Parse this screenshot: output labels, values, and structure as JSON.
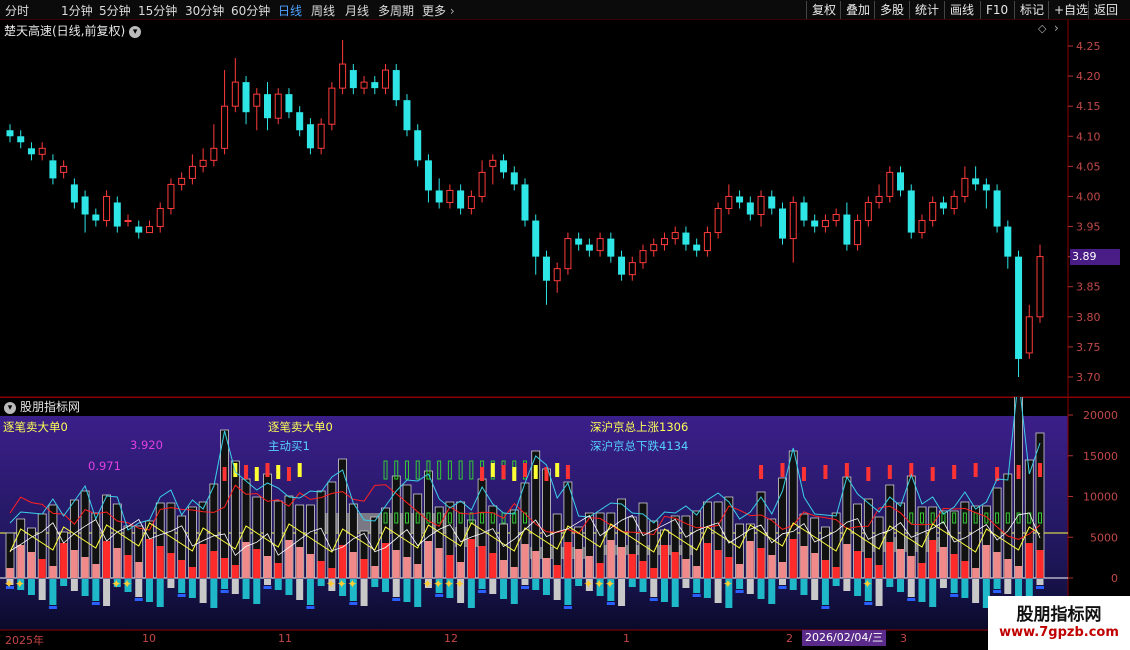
{
  "toolbar": {
    "periods": [
      "分时",
      "1分钟",
      "5分钟",
      "15分钟",
      "30分钟",
      "60分钟",
      "日线",
      "周线",
      "月线",
      "多周期",
      "更多"
    ],
    "active_period": "日线",
    "buttons": [
      "复权",
      "叠加",
      "多股",
      "统计",
      "画线",
      "F10",
      "标记",
      "+自选",
      "返回"
    ]
  },
  "header": {
    "stock_title": "楚天高速(日线,前复权)"
  },
  "price_axis": {
    "ticks": [
      "4.25",
      "4.20",
      "4.15",
      "4.10",
      "4.05",
      "4.00",
      "3.95",
      "3.90",
      "3.85",
      "3.80",
      "3.75",
      "3.70"
    ],
    "cursor_price": "3.89"
  },
  "indicator": {
    "panel_title": "股朋指标网",
    "labels": {
      "big_sell_single_left": "逐笔卖大单0",
      "value_a": "3.920",
      "value_b": "0.971",
      "big_sell_single_mid": "逐笔卖大单0",
      "active_buy": "主动买1",
      "market_up": "深沪京总上涨1306",
      "market_down": "深沪京总下跌4134"
    },
    "axis_ticks": [
      "20000",
      "15000",
      "10000",
      "5000",
      "0"
    ]
  },
  "x_axis": {
    "labels": [
      "2025年",
      "10",
      "11",
      "12",
      "1",
      "2",
      "3"
    ],
    "cursor_date": "2026/02/04/三"
  },
  "watermark": {
    "title": "股朋指标网",
    "url": "www.7gpzb.com"
  },
  "colors": {
    "up": "#ff3b3b",
    "down": "#2ee6e6",
    "axis": "#8b0000",
    "indicator_bg": "#2a1a6e"
  },
  "chart_data": {
    "type": "candlestick",
    "ylim": [
      3.68,
      4.28
    ],
    "candles": [
      [
        4.11,
        4.1,
        4.12,
        4.09
      ],
      [
        4.1,
        4.09,
        4.11,
        4.08
      ],
      [
        4.08,
        4.07,
        4.09,
        4.06
      ],
      [
        4.07,
        4.08,
        4.09,
        4.06
      ],
      [
        4.06,
        4.03,
        4.07,
        4.02
      ],
      [
        4.04,
        4.05,
        4.06,
        4.03
      ],
      [
        4.02,
        3.99,
        4.03,
        3.98
      ],
      [
        4.0,
        3.97,
        4.01,
        3.94
      ],
      [
        3.97,
        3.96,
        3.98,
        3.95
      ],
      [
        3.96,
        4.0,
        4.01,
        3.95
      ],
      [
        3.99,
        3.95,
        4.0,
        3.94
      ],
      [
        3.96,
        3.96,
        3.97,
        3.95
      ],
      [
        3.95,
        3.94,
        3.96,
        3.93
      ],
      [
        3.94,
        3.95,
        3.96,
        3.94
      ],
      [
        3.95,
        3.98,
        3.99,
        3.94
      ],
      [
        3.98,
        4.02,
        4.03,
        3.97
      ],
      [
        4.02,
        4.03,
        4.04,
        4.01
      ],
      [
        4.03,
        4.05,
        4.07,
        4.02
      ],
      [
        4.05,
        4.06,
        4.08,
        4.04
      ],
      [
        4.06,
        4.08,
        4.12,
        4.05
      ],
      [
        4.08,
        4.15,
        4.21,
        4.07
      ],
      [
        4.15,
        4.19,
        4.23,
        4.14
      ],
      [
        4.19,
        4.14,
        4.2,
        4.12
      ],
      [
        4.15,
        4.17,
        4.18,
        4.11
      ],
      [
        4.17,
        4.13,
        4.19,
        4.11
      ],
      [
        4.13,
        4.17,
        4.18,
        4.12
      ],
      [
        4.17,
        4.14,
        4.18,
        4.13
      ],
      [
        4.14,
        4.11,
        4.15,
        4.1
      ],
      [
        4.12,
        4.08,
        4.13,
        4.07
      ],
      [
        4.08,
        4.12,
        4.13,
        4.07
      ],
      [
        4.12,
        4.18,
        4.19,
        4.11
      ],
      [
        4.18,
        4.22,
        4.26,
        4.17
      ],
      [
        4.21,
        4.18,
        4.22,
        4.17
      ],
      [
        4.18,
        4.19,
        4.2,
        4.17
      ],
      [
        4.19,
        4.18,
        4.2,
        4.17
      ],
      [
        4.18,
        4.21,
        4.22,
        4.17
      ],
      [
        4.21,
        4.16,
        4.22,
        4.15
      ],
      [
        4.16,
        4.11,
        4.17,
        4.1
      ],
      [
        4.11,
        4.06,
        4.12,
        4.05
      ],
      [
        4.06,
        4.01,
        4.07,
        3.99
      ],
      [
        4.01,
        3.99,
        4.03,
        3.98
      ],
      [
        3.99,
        4.01,
        4.02,
        3.98
      ],
      [
        4.01,
        3.98,
        4.02,
        3.97
      ],
      [
        3.98,
        4.0,
        4.01,
        3.97
      ],
      [
        4.0,
        4.04,
        4.06,
        3.99
      ],
      [
        4.05,
        4.06,
        4.07,
        4.02
      ],
      [
        4.06,
        4.04,
        4.07,
        4.03
      ],
      [
        4.04,
        4.02,
        4.05,
        4.01
      ],
      [
        4.02,
        3.96,
        4.03,
        3.95
      ],
      [
        3.96,
        3.9,
        3.97,
        3.87
      ],
      [
        3.9,
        3.86,
        3.91,
        3.82
      ],
      [
        3.86,
        3.88,
        3.89,
        3.84
      ],
      [
        3.88,
        3.93,
        3.94,
        3.87
      ],
      [
        3.93,
        3.92,
        3.94,
        3.91
      ],
      [
        3.92,
        3.91,
        3.93,
        3.9
      ],
      [
        3.91,
        3.93,
        3.94,
        3.9
      ],
      [
        3.93,
        3.9,
        3.94,
        3.89
      ],
      [
        3.9,
        3.87,
        3.91,
        3.86
      ],
      [
        3.87,
        3.89,
        3.9,
        3.86
      ],
      [
        3.89,
        3.91,
        3.92,
        3.88
      ],
      [
        3.91,
        3.92,
        3.93,
        3.9
      ],
      [
        3.92,
        3.93,
        3.94,
        3.91
      ],
      [
        3.93,
        3.94,
        3.95,
        3.92
      ],
      [
        3.94,
        3.92,
        3.95,
        3.91
      ],
      [
        3.92,
        3.91,
        3.93,
        3.9
      ],
      [
        3.91,
        3.94,
        3.95,
        3.9
      ],
      [
        3.94,
        3.98,
        3.99,
        3.93
      ],
      [
        3.98,
        4.0,
        4.02,
        3.97
      ],
      [
        4.0,
        3.99,
        4.01,
        3.98
      ],
      [
        3.99,
        3.97,
        4.0,
        3.96
      ],
      [
        3.97,
        4.0,
        4.01,
        3.95
      ],
      [
        4.0,
        3.98,
        4.01,
        3.97
      ],
      [
        3.98,
        3.93,
        3.99,
        3.92
      ],
      [
        3.93,
        3.99,
        4.0,
        3.89
      ],
      [
        3.99,
        3.96,
        4.0,
        3.95
      ],
      [
        3.96,
        3.95,
        3.97,
        3.94
      ],
      [
        3.95,
        3.96,
        3.97,
        3.94
      ],
      [
        3.96,
        3.97,
        3.98,
        3.95
      ],
      [
        3.97,
        3.92,
        3.99,
        3.91
      ],
      [
        3.92,
        3.96,
        3.97,
        3.91
      ],
      [
        3.96,
        3.99,
        4.0,
        3.95
      ],
      [
        3.99,
        4.0,
        4.02,
        3.98
      ],
      [
        4.0,
        4.04,
        4.05,
        3.99
      ],
      [
        4.04,
        4.01,
        4.05,
        4.0
      ],
      [
        4.01,
        3.94,
        4.02,
        3.93
      ],
      [
        3.94,
        3.96,
        3.97,
        3.93
      ],
      [
        3.96,
        3.99,
        4.0,
        3.95
      ],
      [
        3.99,
        3.98,
        4.0,
        3.97
      ],
      [
        3.98,
        4.0,
        4.01,
        3.97
      ],
      [
        4.0,
        4.03,
        4.05,
        3.99
      ],
      [
        4.03,
        4.02,
        4.05,
        4.01
      ],
      [
        4.02,
        4.01,
        4.03,
        3.98
      ],
      [
        4.01,
        3.95,
        4.02,
        3.94
      ],
      [
        3.95,
        3.9,
        3.96,
        3.88
      ],
      [
        3.9,
        3.73,
        3.91,
        3.7
      ],
      [
        3.74,
        3.8,
        3.82,
        3.73
      ],
      [
        3.8,
        3.9,
        3.92,
        3.79
      ]
    ]
  }
}
